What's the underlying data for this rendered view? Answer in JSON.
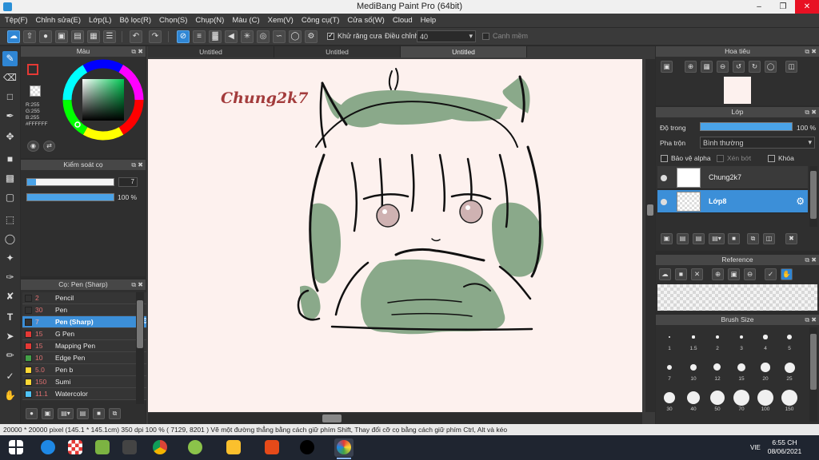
{
  "window": {
    "title": "MediBang Paint Pro (64bit)",
    "min_icon": "minimize-icon",
    "max_icon": "maximize-icon",
    "close_icon": "close-icon"
  },
  "menu": [
    "Tệp(F)",
    "Chỉnh sửa(E)",
    "Lớp(L)",
    "Bộ lọc(R)",
    "Chọn(S)",
    "Chụp(N)",
    "Màu (C)",
    "Xem(V)",
    "Công cụ(T)",
    "Cửa số(W)",
    "Cloud",
    "Help"
  ],
  "toolbar": {
    "antialias_label": "Khử răng cưa",
    "antialias_checked": true,
    "adjust_label": "Điều chỉnh",
    "adjust_value": "40",
    "smooth_label": "Canh mềm",
    "smooth_checked": false
  },
  "color_panel": {
    "title": "Màu",
    "r": "R:255",
    "g": "G:255",
    "b": "B:255",
    "hex": "#FFFFFF",
    "foreground": "#ffffff",
    "background": "#ffffff"
  },
  "brush_control": {
    "title": "Kiểm soát cọ",
    "size_value": "7",
    "size_fraction": 0.1,
    "opacity_value": "100 %",
    "opacity_fraction": 1.0
  },
  "brush_list": {
    "title": "Cọ: Pen (Sharp)",
    "items": [
      {
        "size": "2",
        "name": "Pencil",
        "color": "#333333",
        "selected": false
      },
      {
        "size": "30",
        "name": "Pen",
        "color": "#333333",
        "selected": false
      },
      {
        "size": "7",
        "name": "Pen (Sharp)",
        "color": "#333333",
        "selected": true
      },
      {
        "size": "15",
        "name": "G Pen",
        "color": "#e53935",
        "selected": false
      },
      {
        "size": "15",
        "name": "Mapping Pen",
        "color": "#e53935",
        "selected": false
      },
      {
        "size": "10",
        "name": "Edge Pen",
        "color": "#43a047",
        "selected": false
      },
      {
        "size": "5.0",
        "name": "Pen b",
        "color": "#fdd835",
        "selected": false
      },
      {
        "size": "150",
        "name": "Sumi",
        "color": "#fdd835",
        "selected": false
      },
      {
        "size": "11.1",
        "name": "Watercolor",
        "color": "#4fc3f7",
        "selected": false
      }
    ]
  },
  "tabs": [
    {
      "label": "Untitled",
      "active": false
    },
    {
      "label": "Untitled",
      "active": false
    },
    {
      "label": "Untitled",
      "active": true
    }
  ],
  "canvas": {
    "signature": "Chung2k7",
    "paper_color": "#fdf1ee",
    "hair_color": "#8aa98a",
    "line_color": "#111111"
  },
  "navigator": {
    "title": "Hoa tiêu"
  },
  "layers": {
    "title": "Lớp",
    "opacity_label": "Độ trong",
    "opacity_value": "100 %",
    "opacity_fraction": 1.0,
    "blend_label": "Pha trộn",
    "blend_value": "Bình thường",
    "protect_alpha": "Bảo vệ alpha",
    "clipping": "Xén bớt",
    "lock": "Khóa",
    "items": [
      {
        "name": "Chung2k7",
        "selected": false
      },
      {
        "name": "Lớp8",
        "selected": true
      }
    ]
  },
  "reference": {
    "title": "Reference"
  },
  "brush_size": {
    "title": "Brush Size",
    "sizes": [
      "1",
      "1.5",
      "2",
      "3",
      "4",
      "5",
      "7",
      "10",
      "12",
      "15",
      "20",
      "25",
      "30",
      "40",
      "50",
      "70",
      "100",
      "150"
    ]
  },
  "status": {
    "text": "20000 * 20000 pixel   (145.1 * 145.1cm)   350 dpi   100 %   ( 7129, 8201 )   Vẽ một đường thẳng bằng cách giữ phím Shift, Thay đổi cỡ cọ bằng cách giữ phím Ctrl, Alt và kéo"
  },
  "taskbar": {
    "time": "6:55 CH",
    "date": "08/06/2021",
    "lang": "VIE"
  }
}
